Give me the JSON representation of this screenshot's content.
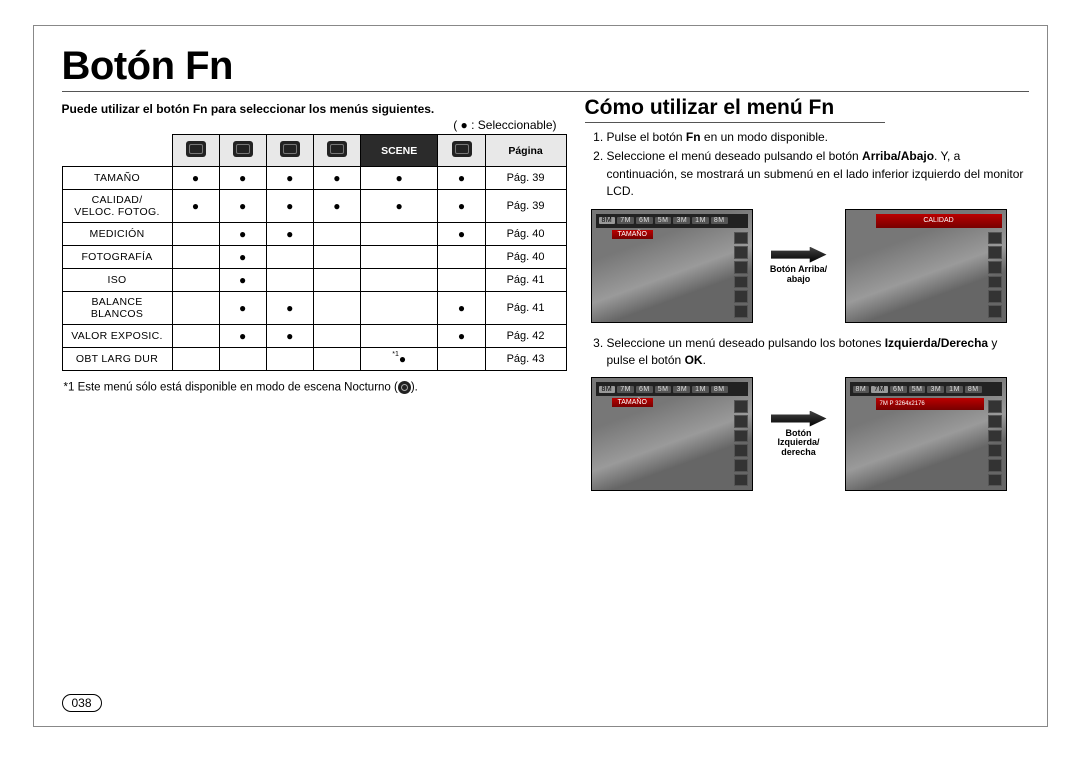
{
  "title": "Botón Fn",
  "page_number": "038",
  "left": {
    "intro": "Puede utilizar el botón Fn para seleccionar los menús siguientes.",
    "selectable_hint": "( ● : Seleccionable)",
    "table": {
      "header": {
        "scene": "SCENE",
        "page": "Página"
      },
      "rows": [
        {
          "label": "TAMAÑO",
          "c": [
            "●",
            "●",
            "●",
            "●",
            "●",
            "●"
          ],
          "page": "Pág. 39"
        },
        {
          "label": "CALIDAD/\nVELOC. FOTOG.",
          "c": [
            "●",
            "●",
            "●",
            "●",
            "●",
            "●"
          ],
          "page": "Pág. 39"
        },
        {
          "label": "MEDICIÓN",
          "c": [
            "",
            "●",
            "●",
            "",
            "",
            "●"
          ],
          "page": "Pág. 40"
        },
        {
          "label": "FOTOGRAFÍA",
          "c": [
            "",
            "●",
            "",
            "",
            "",
            ""
          ],
          "page": "Pág. 40"
        },
        {
          "label": "ISO",
          "c": [
            "",
            "●",
            "",
            "",
            "",
            ""
          ],
          "page": "Pág. 41"
        },
        {
          "label": "BALANCE\nBLANCOS",
          "c": [
            "",
            "●",
            "●",
            "",
            "",
            "●"
          ],
          "page": "Pág. 41"
        },
        {
          "label": "VALOR EXPOSIC.",
          "c": [
            "",
            "●",
            "●",
            "",
            "",
            "●"
          ],
          "page": "Pág. 42"
        },
        {
          "label": "OBT LARG DUR",
          "c": [
            "",
            "",
            "",
            "",
            "*1●",
            ""
          ],
          "page": "Pág. 43"
        }
      ]
    },
    "footnote_prefix": "*1 Este menú sólo está disponible en modo de escena Nocturno (",
    "footnote_suffix": ")."
  },
  "right": {
    "subhead": "Cómo utilizar el menú Fn",
    "step1_a": "Pulse el botón ",
    "step1_b": "Fn",
    "step1_c": " en un modo disponible.",
    "step2_a": "Seleccione el menú deseado pulsando el botón ",
    "step2_b": "Arriba/Abajo",
    "step2_c": ". Y, a continuación, se mostrará un submenú en el lado inferior izquierdo del monitor LCD.",
    "arrow1_a": "Botón ",
    "arrow1_b": "Arriba/\nabajo",
    "step3_a": "Seleccione un menú deseado pulsando los botones ",
    "step3_b": "Izquierda/Derecha",
    "step3_c": " y pulse el botón ",
    "step3_d": "OK",
    "step3_e": ".",
    "arrow2_a": "Botón\n",
    "arrow2_b": "Izquierda/\nderecha",
    "screen_labels": {
      "tamano": "TAMAÑO",
      "calidad": "CALIDAD",
      "chips": [
        "8M",
        "7M",
        "6M",
        "5M",
        "3M",
        "1M",
        "8M"
      ],
      "chips2": [
        "8M",
        "7M",
        "6M",
        "5M",
        "3M",
        "1M",
        "8M"
      ],
      "corner": "8M",
      "res": "7M P 3264x2176"
    }
  }
}
